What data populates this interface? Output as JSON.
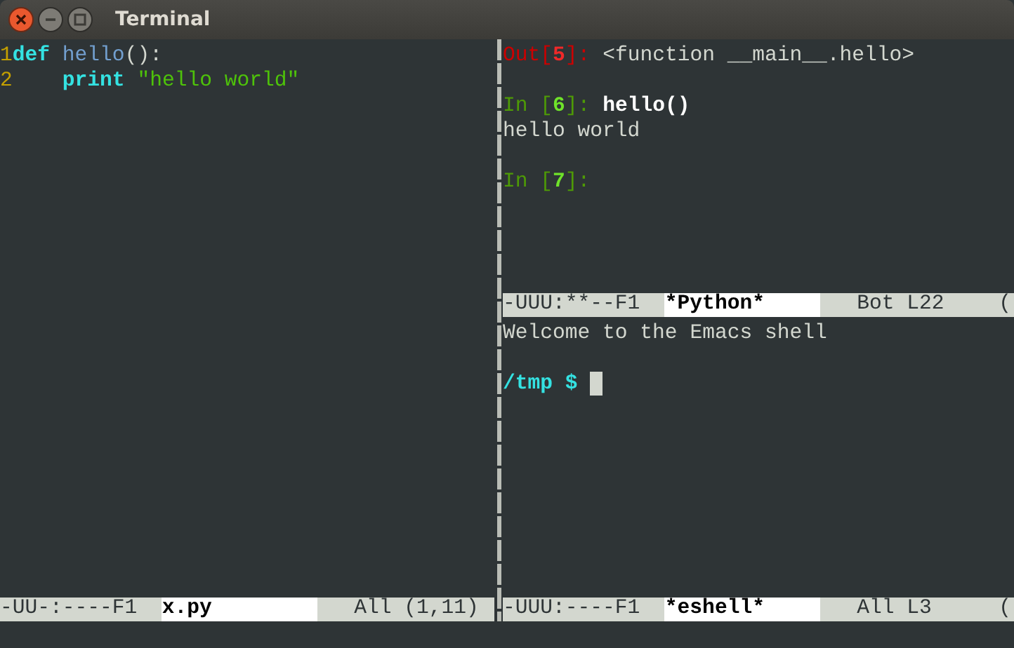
{
  "window": {
    "title": "Terminal"
  },
  "left_pane": {
    "lines": [
      {
        "number": "1",
        "kind": "code",
        "tokens": [
          {
            "text": "def",
            "kind": "keyword"
          },
          {
            "text": " hello",
            "kind": "function"
          },
          {
            "text": "():",
            "kind": "plain"
          }
        ]
      },
      {
        "number": "2",
        "kind": "code",
        "tokens": [
          {
            "text": "    print",
            "kind": "keyword"
          },
          {
            "text": " \"hello world\"",
            "kind": "string"
          }
        ]
      }
    ],
    "mode_line": {
      "status": "-UU-:----F1",
      "buffer": "x.py",
      "position": "All (1,11)"
    }
  },
  "python_pane": {
    "lines": [
      {
        "kind": "code",
        "tokens": [
          {
            "text": "Out[",
            "kind": "out-prompt"
          },
          {
            "text": "5",
            "kind": "out-number"
          },
          {
            "text": "]: ",
            "kind": "out-prompt"
          },
          {
            "text": "<function __main__.hello>",
            "kind": "plain"
          }
        ]
      },
      {
        "kind": "blank"
      },
      {
        "kind": "code",
        "tokens": [
          {
            "text": "In [",
            "kind": "in-prompt"
          },
          {
            "text": "6",
            "kind": "in-number"
          },
          {
            "text": "]: ",
            "kind": "in-prompt"
          },
          {
            "text": "hello()",
            "kind": "input"
          }
        ]
      },
      {
        "kind": "code",
        "tokens": [
          {
            "text": "hello world",
            "kind": "plain"
          }
        ]
      },
      {
        "kind": "blank"
      },
      {
        "kind": "code",
        "tokens": [
          {
            "text": "In [",
            "kind": "in-prompt"
          },
          {
            "text": "7",
            "kind": "in-number"
          },
          {
            "text": "]:",
            "kind": "in-prompt"
          }
        ]
      }
    ],
    "mode_line": {
      "status": "-UUU:**--F1",
      "buffer": "*Python*",
      "position": "Bot L22",
      "overflow": "("
    }
  },
  "eshell_pane": {
    "lines": [
      {
        "kind": "code",
        "tokens": [
          {
            "text": "Welcome to the Emacs shell",
            "kind": "plain"
          }
        ]
      },
      {
        "kind": "blank"
      },
      {
        "kind": "prompt",
        "tokens": [
          {
            "text": "/tmp $",
            "kind": "shell-prompt"
          }
        ]
      }
    ],
    "mode_line": {
      "status": "-UUU:----F1",
      "buffer": "*eshell*",
      "position": "All L3",
      "overflow": "("
    }
  }
}
